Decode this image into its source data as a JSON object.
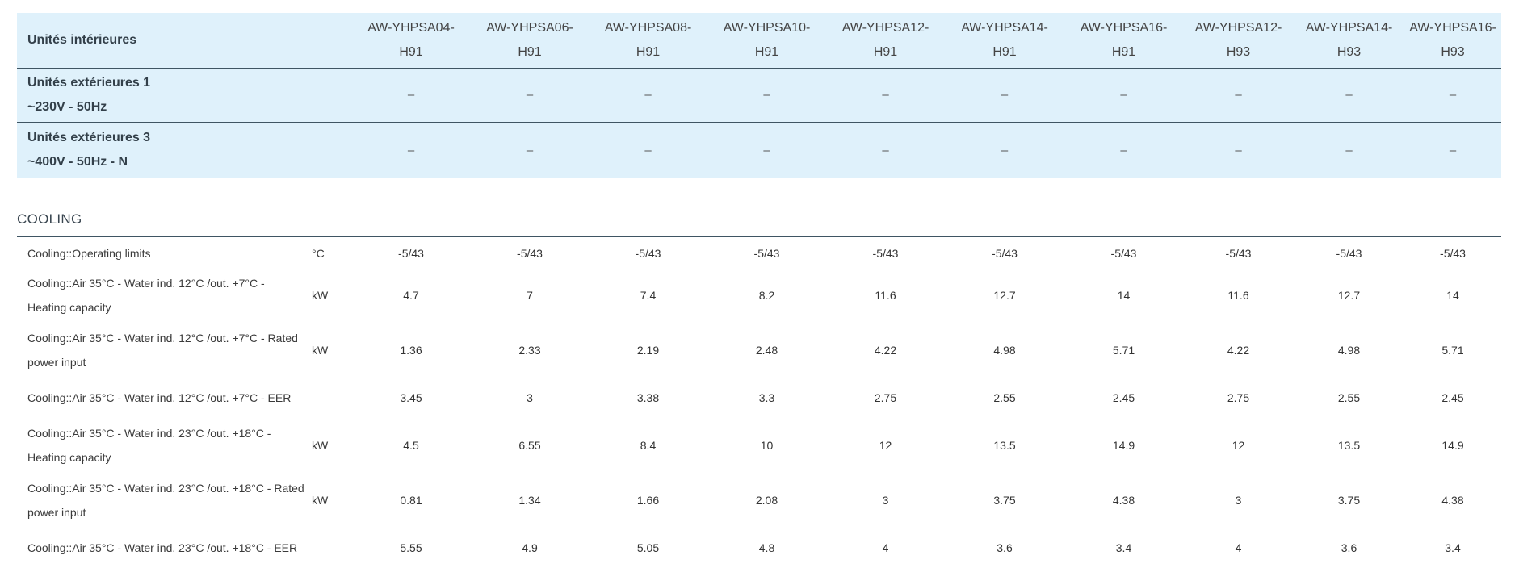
{
  "header": {
    "indoor_label": "Unités intérieures",
    "models": [
      [
        "AW-YHPSA04-",
        "H91"
      ],
      [
        "AW-YHPSA06-",
        "H91"
      ],
      [
        "AW-YHPSA08-",
        "H91"
      ],
      [
        "AW-YHPSA10-",
        "H91"
      ],
      [
        "AW-YHPSA12-",
        "H91"
      ],
      [
        "AW-YHPSA14-",
        "H91"
      ],
      [
        "AW-YHPSA16-",
        "H91"
      ],
      [
        "AW-YHPSA12-",
        "H93"
      ],
      [
        "AW-YHPSA14-",
        "H93"
      ],
      [
        "AW-YHPSA16-",
        "H93"
      ]
    ],
    "outdoor_rows": [
      {
        "line1": "Unités extérieures 1",
        "line2": "~230V - 50Hz",
        "values": [
          "–",
          "–",
          "–",
          "–",
          "–",
          "–",
          "–",
          "–",
          "–",
          "–"
        ]
      },
      {
        "line1": "Unités extérieures 3",
        "line2": "~400V - 50Hz - N",
        "values": [
          "–",
          "–",
          "–",
          "–",
          "–",
          "–",
          "–",
          "–",
          "–",
          "–"
        ]
      }
    ]
  },
  "section": {
    "title": "COOLING"
  },
  "rows": [
    {
      "label": "Cooling::Operating limits",
      "unit": "°C",
      "values": [
        "-5/43",
        "-5/43",
        "-5/43",
        "-5/43",
        "-5/43",
        "-5/43",
        "-5/43",
        "-5/43",
        "-5/43",
        "-5/43"
      ]
    },
    {
      "label": "Cooling::Air 35°C - Water ind. 12°C /out. +7°C - Heating capacity",
      "unit": "kW",
      "values": [
        "4.7",
        "7",
        "7.4",
        "8.2",
        "11.6",
        "12.7",
        "14",
        "11.6",
        "12.7",
        "14"
      ]
    },
    {
      "label": "Cooling::Air 35°C - Water ind. 12°C /out. +7°C - Rated power input",
      "unit": "kW",
      "values": [
        "1.36",
        "2.33",
        "2.19",
        "2.48",
        "4.22",
        "4.98",
        "5.71",
        "4.22",
        "4.98",
        "5.71"
      ]
    },
    {
      "label": "Cooling::Air 35°C - Water ind. 12°C /out. +7°C - EER",
      "unit": "",
      "values": [
        "3.45",
        "3",
        "3.38",
        "3.3",
        "2.75",
        "2.55",
        "2.45",
        "2.75",
        "2.55",
        "2.45"
      ]
    },
    {
      "label": "Cooling::Air 35°C - Water ind. 23°C /out. +18°C - Heating capacity",
      "unit": "kW",
      "values": [
        "4.5",
        "6.55",
        "8.4",
        "10",
        "12",
        "13.5",
        "14.9",
        "12",
        "13.5",
        "14.9"
      ]
    },
    {
      "label": "Cooling::Air 35°C - Water ind. 23°C /out. +18°C - Rated power input",
      "unit": "kW",
      "values": [
        "0.81",
        "1.34",
        "1.66",
        "2.08",
        "3",
        "3.75",
        "4.38",
        "3",
        "3.75",
        "4.38"
      ]
    },
    {
      "label": "Cooling::Air 35°C - Water ind. 23°C /out. +18°C - EER",
      "unit": "",
      "values": [
        "5.55",
        "4.9",
        "5.05",
        "4.8",
        "4",
        "3.6",
        "3.4",
        "4",
        "3.6",
        "3.4"
      ]
    }
  ]
}
